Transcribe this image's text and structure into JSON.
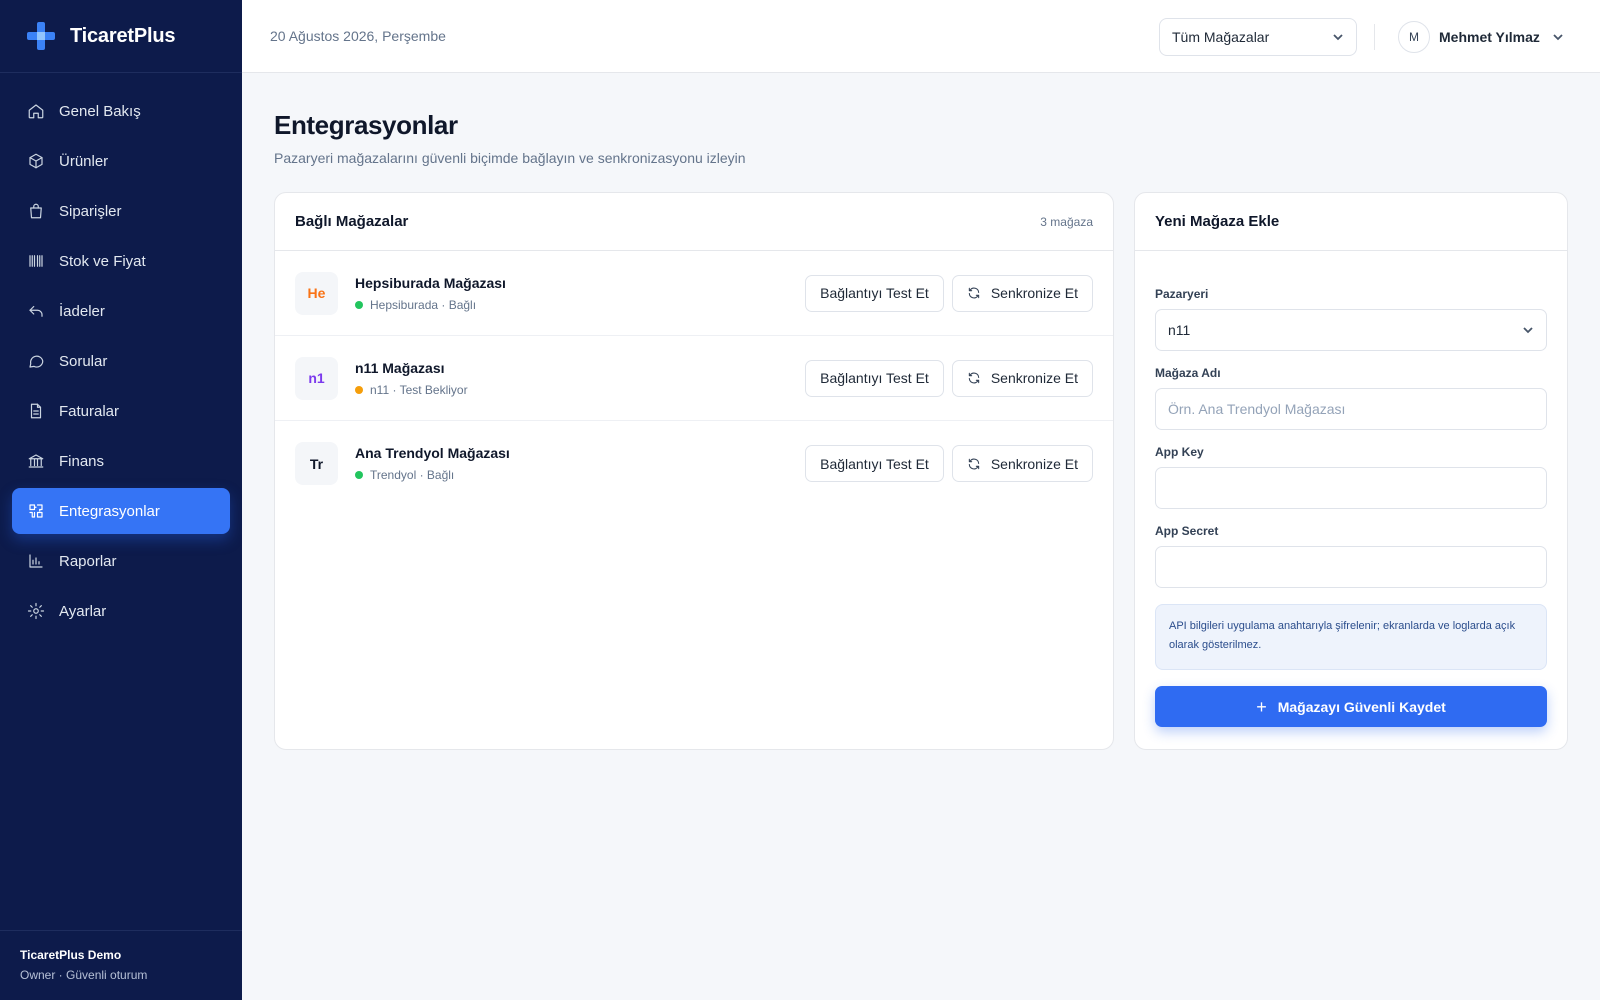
{
  "brand": {
    "name": "TicaretPlus"
  },
  "nav": [
    {
      "key": "overview",
      "label": "Genel Bakış",
      "icon": "home-icon"
    },
    {
      "key": "products",
      "label": "Ürünler",
      "icon": "box-icon"
    },
    {
      "key": "orders",
      "label": "Siparişler",
      "icon": "bag-icon"
    },
    {
      "key": "stock",
      "label": "Stok ve Fiyat",
      "icon": "barcode-icon"
    },
    {
      "key": "returns",
      "label": "İadeler",
      "icon": "return-icon"
    },
    {
      "key": "questions",
      "label": "Sorular",
      "icon": "chat-icon"
    },
    {
      "key": "invoices",
      "label": "Faturalar",
      "icon": "document-icon"
    },
    {
      "key": "finance",
      "label": "Finans",
      "icon": "bank-icon"
    },
    {
      "key": "integrations",
      "label": "Entegrasyonlar",
      "icon": "puzzle-icon",
      "active": true
    },
    {
      "key": "reports",
      "label": "Raporlar",
      "icon": "bar-chart-icon"
    },
    {
      "key": "settings",
      "label": "Ayarlar",
      "icon": "gear-icon"
    }
  ],
  "sidebar_footer": {
    "title": "TicaretPlus Demo",
    "subtitle": "Owner · Güvenli oturum"
  },
  "header": {
    "date": "20 Ağustos 2026, Perşembe",
    "store_filter": "Tüm Mağazalar",
    "user_initial": "M",
    "user_name": "Mehmet Yılmaz"
  },
  "page": {
    "title": "Entegrasyonlar",
    "subtitle": "Pazaryeri mağazalarını güvenli biçimde bağlayın ve senkronizasyonu izleyin"
  },
  "connected": {
    "title": "Bağlı Mağazalar",
    "count": "3 mağaza",
    "test_label": "Bağlantıyı Test Et",
    "sync_label": "Senkronize Et",
    "stores": [
      {
        "badge": "He",
        "badge_color": "#f97316",
        "name": "Hepsiburada Mağazası",
        "status": "Hepsiburada · Bağlı",
        "status_color": "#22c55e"
      },
      {
        "badge": "n1",
        "badge_color": "#7c3aed",
        "name": "n11 Mağazası",
        "status": "n11 · Test Bekliyor",
        "status_color": "#f59e0b"
      },
      {
        "badge": "Tr",
        "badge_color": "#0f172a",
        "name": "Ana Trendyol Mağazası",
        "status": "Trendyol · Bağlı",
        "status_color": "#22c55e"
      }
    ]
  },
  "new_store": {
    "title": "Yeni Mağaza Ekle",
    "marketplace_label": "Pazaryeri",
    "marketplace_value": "n11",
    "store_name_label": "Mağaza Adı",
    "store_name_placeholder": "Örn. Ana Trendyol Mağazası",
    "app_key_label": "App Key",
    "app_key_value": "",
    "app_secret_label": "App Secret",
    "app_secret_value": "",
    "info": "API bilgileri uygulama anahtarıyla şifrelenir; ekranlarda ve loglarda açık olarak gösterilmez.",
    "save_label": "Mağazayı Güvenli Kaydet"
  },
  "colors": {
    "sidebar": "#0d1b4b",
    "accent": "#3574f5",
    "connected": "#22c55e",
    "pending": "#f59e0b"
  }
}
